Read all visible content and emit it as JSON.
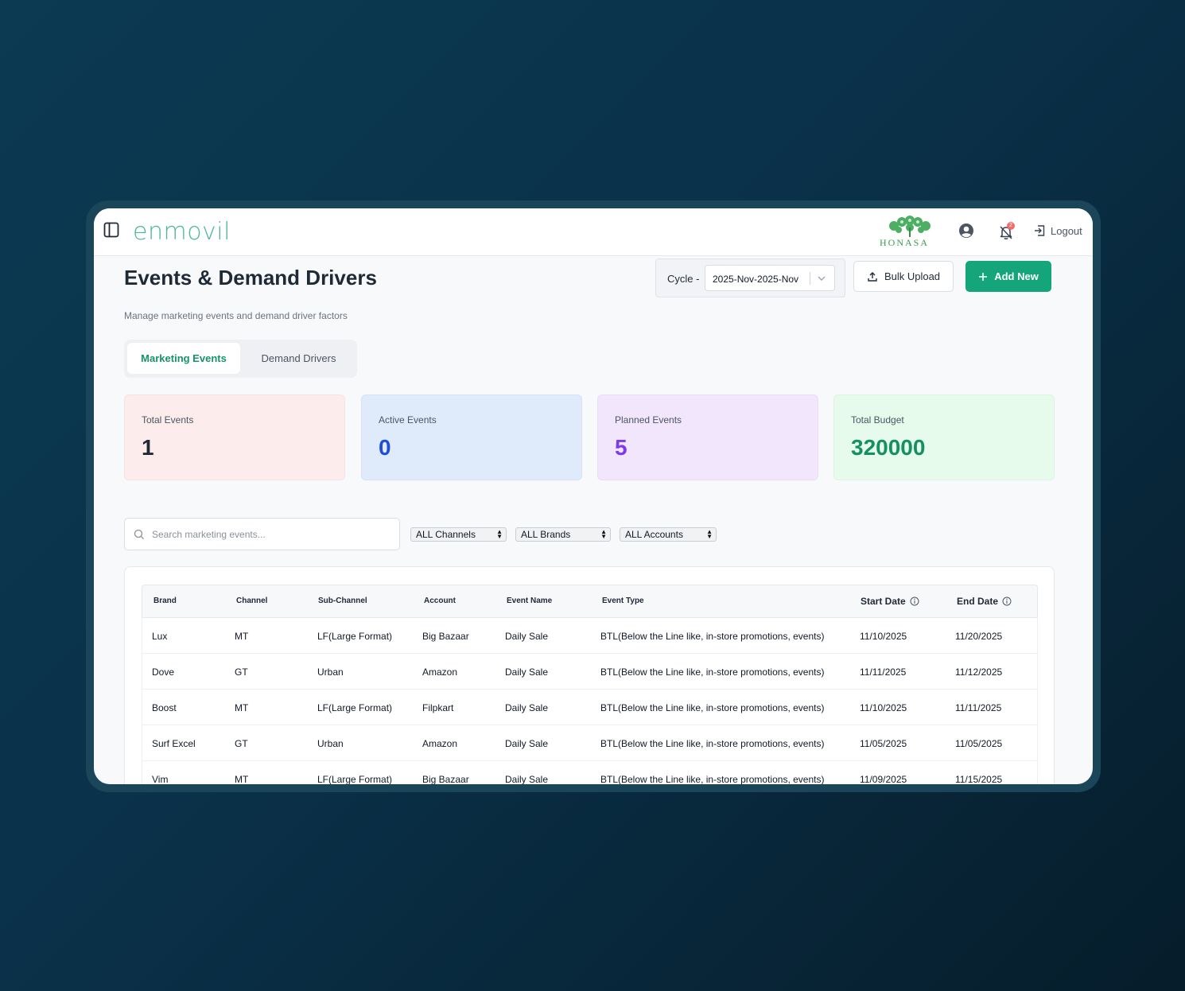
{
  "app": {
    "logo_text": "enmovil",
    "brand_logo_text": "HONASA",
    "notification_count": "2",
    "logout_label": "Logout"
  },
  "header": {
    "title": "Events & Demand Drivers",
    "subtitle": "Manage marketing events and demand driver factors",
    "cycle_label": "Cycle -",
    "cycle_value": "2025-Nov-2025-Nov",
    "bulk_upload_label": "Bulk Upload",
    "add_new_label": "Add New"
  },
  "tabs": [
    {
      "label": "Marketing Events",
      "active": true
    },
    {
      "label": "Demand Drivers",
      "active": false
    }
  ],
  "stats": [
    {
      "label": "Total Events",
      "value": "1"
    },
    {
      "label": "Active Events",
      "value": "0"
    },
    {
      "label": "Planned Events",
      "value": "5"
    },
    {
      "label": "Total Budget",
      "value": "320000"
    }
  ],
  "filters": {
    "search_placeholder": "Search marketing events...",
    "channels": "ALL Channels",
    "brands": "ALL Brands",
    "accounts": "ALL Accounts"
  },
  "table": {
    "columns": [
      "Brand",
      "Channel",
      "Sub-Channel",
      "Account",
      "Event Name",
      "Event Type",
      "Start Date",
      "End Date"
    ],
    "rows": [
      [
        "Lux",
        "MT",
        "LF(Large Format)",
        "Big Bazaar",
        "Daily Sale",
        "BTL(Below the Line like, in-store promotions, events)",
        "11/10/2025",
        "11/20/2025"
      ],
      [
        "Dove",
        "GT",
        "Urban",
        "Amazon",
        "Daily Sale",
        "BTL(Below the Line like, in-store promotions, events)",
        "11/11/2025",
        "11/12/2025"
      ],
      [
        "Boost",
        "MT",
        "LF(Large Format)",
        "Filpkart",
        "Daily Sale",
        "BTL(Below the Line like, in-store promotions, events)",
        "11/10/2025",
        "11/11/2025"
      ],
      [
        "Surf Excel",
        "GT",
        "Urban",
        "Amazon",
        "Daily Sale",
        "BTL(Below the Line like, in-store promotions, events)",
        "11/05/2025",
        "11/05/2025"
      ],
      [
        "Vim",
        "MT",
        "LF(Large Format)",
        "Big Bazaar",
        "Daily Sale",
        "BTL(Below the Line like, in-store promotions, events)",
        "11/09/2025",
        "11/15/2025"
      ]
    ]
  },
  "colors": {
    "accent": "#14a67a",
    "total_events_bg": "#fdecec",
    "active_events_bg": "#dfeafb",
    "planned_events_bg": "#f2e6fc",
    "total_budget_bg": "#e6fbeb"
  },
  "icons": [
    "sidebar-toggle-icon",
    "user-icon",
    "bell-off-icon",
    "logout-icon",
    "chevron-down-icon",
    "upload-icon",
    "plus-icon",
    "search-icon",
    "info-icon"
  ]
}
